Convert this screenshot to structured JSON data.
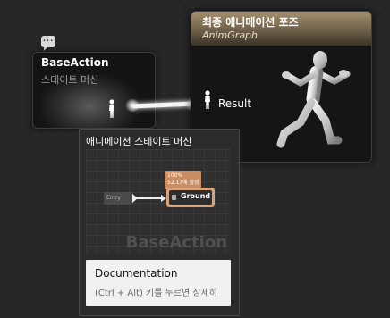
{
  "state_machine_node": {
    "title": "BaseAction",
    "subtitle": "스테이트 머신",
    "output_pin_icon": "person-pose-icon",
    "comment_icon": "comment-bubble-icon"
  },
  "final_pose_node": {
    "title": "최종 애니메이션 포즈",
    "subtitle": "AnimGraph",
    "input_pin_label": "Result",
    "input_pin_icon": "person-pose-icon",
    "preview_icon": "mannequin-running-icon",
    "header_color": "#a4906f"
  },
  "tooltip": {
    "title": "애니메이션 스테이트 머신",
    "preview": {
      "entry_label": "Entry",
      "state_label": "Ground",
      "badge_line1": "100%",
      "badge_line2": "52.13에 활성",
      "watermark": "BaseAction",
      "state_color": "#d9a37a"
    },
    "documentation": {
      "title": "Documentation",
      "hint": "(Ctrl + Alt) 키를 누르면 상세히"
    }
  },
  "colors": {
    "canvas_background": "#262626",
    "wire": "#f4f4f4"
  }
}
